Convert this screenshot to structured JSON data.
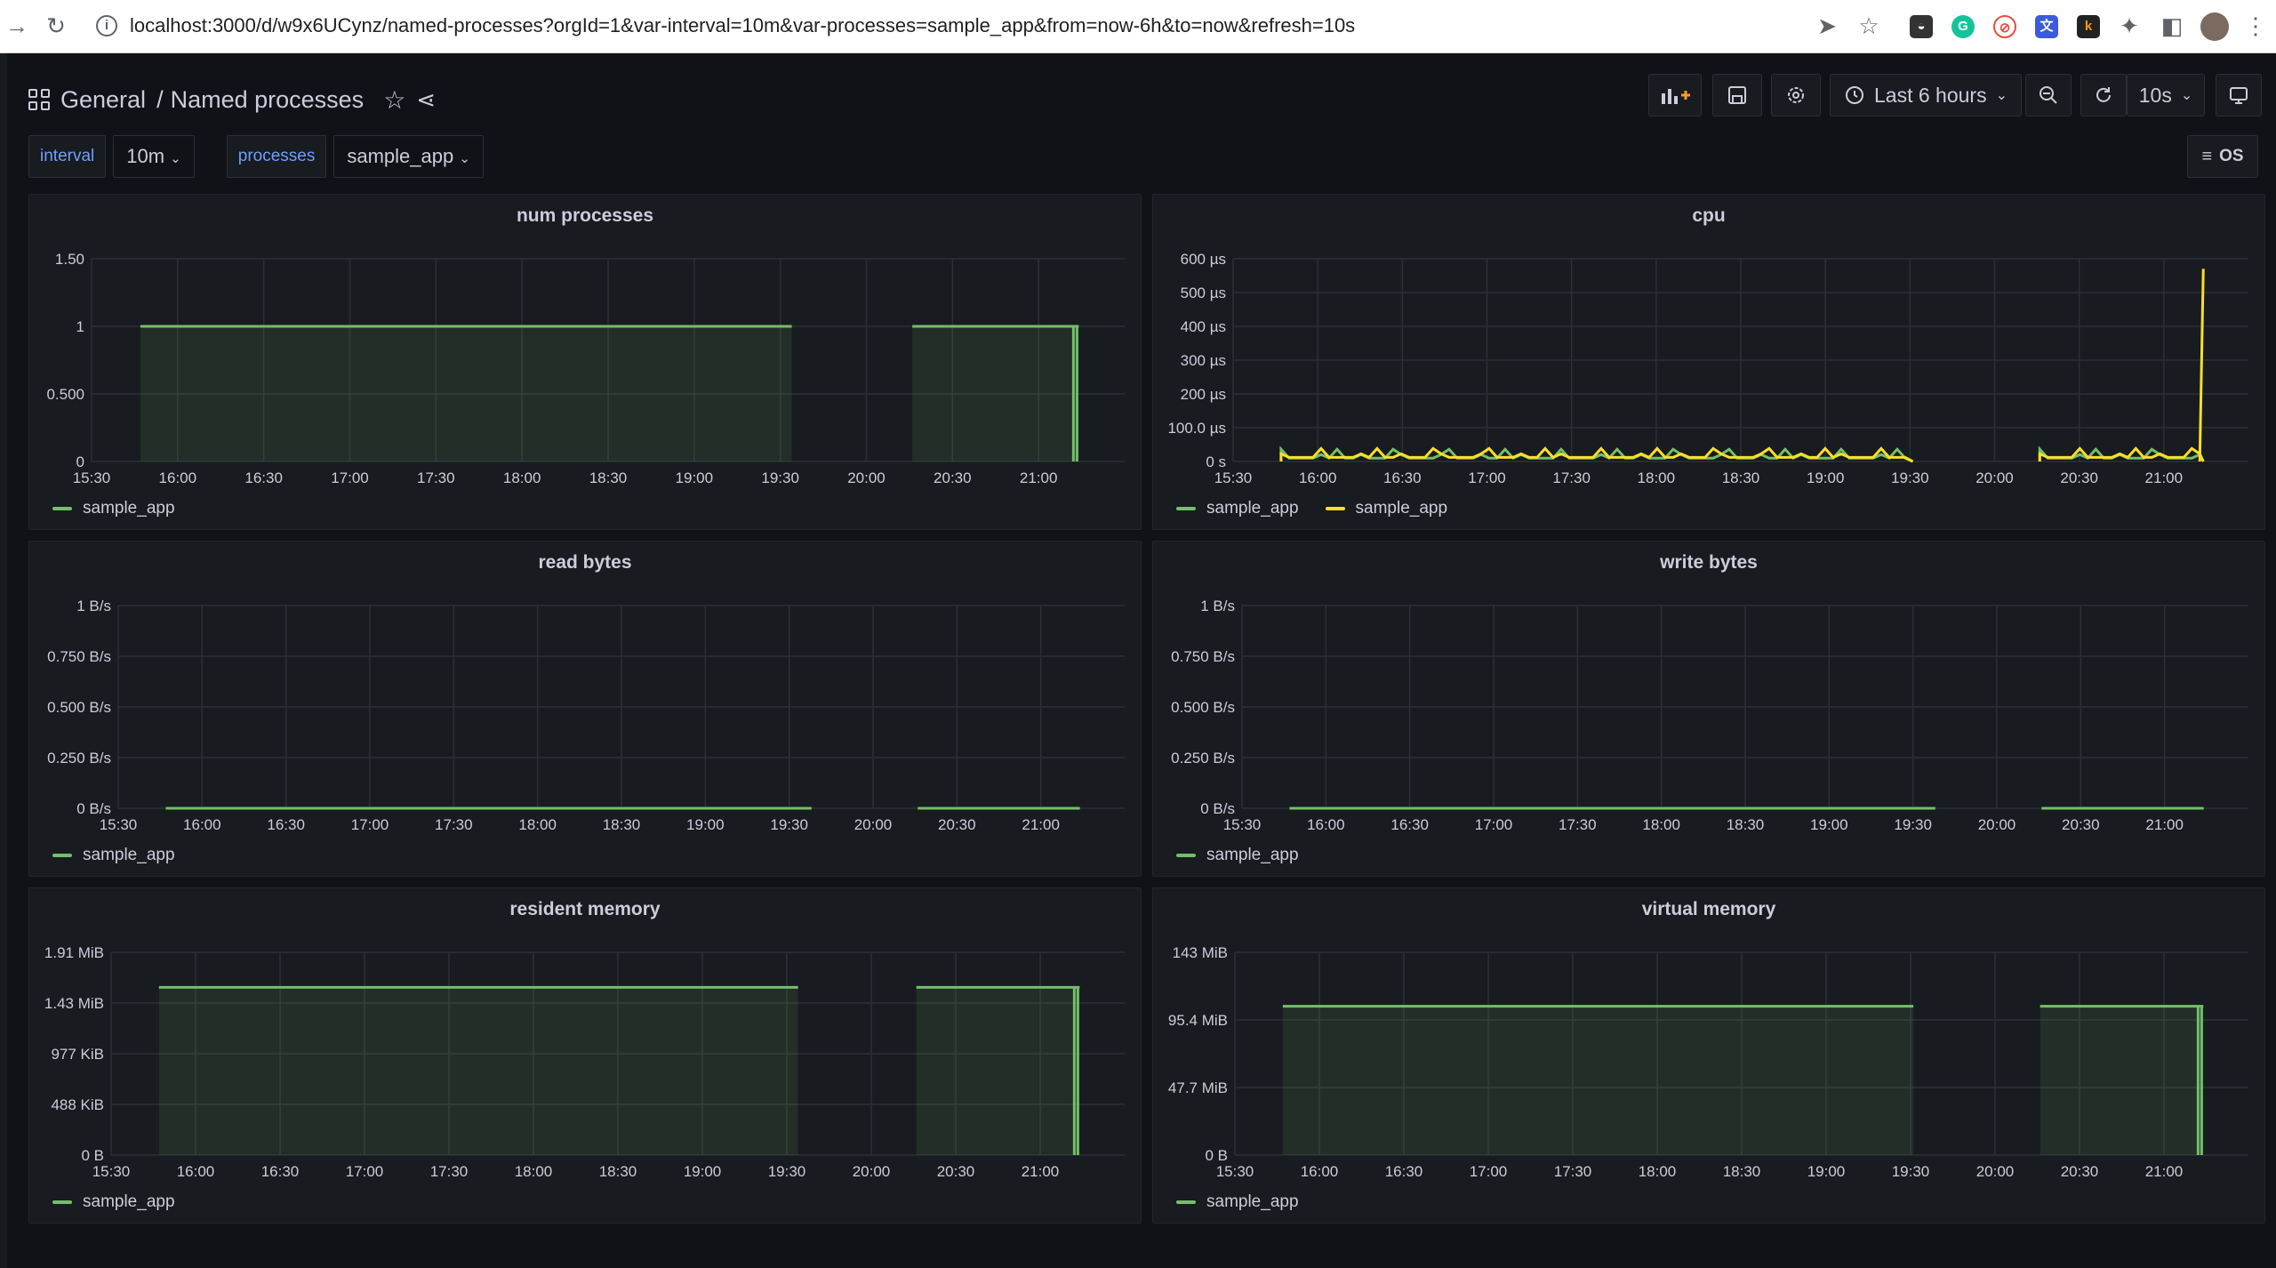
{
  "browser": {
    "url": "localhost:3000/d/w9x6UCynz/named-processes?orgId=1&var-interval=10m&var-processes=sample_app&from=now-6h&to=now&refresh=10s"
  },
  "dashboard": {
    "folder": "General",
    "separator": "/",
    "name": "Named processes"
  },
  "toolbar": {
    "time_range": "Last 6 hours",
    "refresh": "10s"
  },
  "variables": [
    {
      "label": "interval",
      "value": "10m"
    },
    {
      "label": "processes",
      "value": "sample_app"
    }
  ],
  "os_button": "OS",
  "colors": {
    "green": "#73bf69",
    "yellow": "#fade2a",
    "background": "#111217",
    "panel": "#181b1f"
  },
  "x_ticks": [
    "15:30",
    "16:00",
    "16:30",
    "17:00",
    "17:30",
    "18:00",
    "18:30",
    "19:00",
    "19:30",
    "20:00",
    "20:30",
    "21:00"
  ],
  "panels": [
    {
      "title": "num processes",
      "legend": [
        "sample_app"
      ]
    },
    {
      "title": "cpu",
      "legend": [
        "sample_app",
        "sample_app"
      ]
    },
    {
      "title": "read bytes",
      "legend": [
        "sample_app"
      ]
    },
    {
      "title": "write bytes",
      "legend": [
        "sample_app"
      ]
    },
    {
      "title": "resident memory",
      "legend": [
        "sample_app"
      ]
    },
    {
      "title": "virtual memory",
      "legend": [
        "sample_app"
      ]
    }
  ],
  "chart_data": [
    {
      "type": "area",
      "title": "num processes",
      "y_ticks": [
        "0",
        "0.500",
        "1",
        "1.50"
      ],
      "ylim": [
        0,
        1.5
      ],
      "x_range": [
        "15:30",
        "21:30"
      ],
      "series": [
        {
          "name": "sample_app",
          "color": "#73bf69",
          "segments": [
            {
              "x_start": "15:47",
              "x_end": "19:34",
              "value": 1
            },
            {
              "x_start": "20:16",
              "x_end": "21:14",
              "value": 1
            }
          ]
        }
      ]
    },
    {
      "type": "line",
      "title": "cpu",
      "y_ticks": [
        "0 s",
        "100.0 µs",
        "200 µs",
        "300 µs",
        "400 µs",
        "500 µs",
        "600 µs"
      ],
      "ylim": [
        0,
        600
      ],
      "unit": "µs",
      "x_range": [
        "15:30",
        "21:30"
      ],
      "series": [
        {
          "name": "sample_app",
          "color": "#73bf69",
          "segments": [
            {
              "x_start": "15:47",
              "x_end": "19:31",
              "value": 10
            },
            {
              "x_start": "20:16",
              "x_end": "21:14",
              "value": 10
            }
          ]
        },
        {
          "name": "sample_app",
          "color": "#fade2a",
          "segments": [
            {
              "x_start": "15:47",
              "x_end": "19:31",
              "value": 12
            },
            {
              "x_start": "20:16",
              "x_end": "21:14",
              "value": 12
            }
          ],
          "spike": {
            "x": "21:14",
            "value": 570
          }
        }
      ]
    },
    {
      "type": "line",
      "title": "read bytes",
      "y_ticks": [
        "0 B/s",
        "0.250 B/s",
        "0.500 B/s",
        "0.750 B/s",
        "1 B/s"
      ],
      "ylim": [
        0,
        1
      ],
      "x_range": [
        "15:30",
        "21:30"
      ],
      "series": [
        {
          "name": "sample_app",
          "color": "#73bf69",
          "segments": [
            {
              "x_start": "15:47",
              "x_end": "19:38",
              "value": 0
            },
            {
              "x_start": "20:16",
              "x_end": "21:14",
              "value": 0
            }
          ]
        }
      ]
    },
    {
      "type": "line",
      "title": "write bytes",
      "y_ticks": [
        "0 B/s",
        "0.250 B/s",
        "0.500 B/s",
        "0.750 B/s",
        "1 B/s"
      ],
      "ylim": [
        0,
        1
      ],
      "x_range": [
        "15:30",
        "21:30"
      ],
      "series": [
        {
          "name": "sample_app",
          "color": "#73bf69",
          "segments": [
            {
              "x_start": "15:47",
              "x_end": "19:38",
              "value": 0
            },
            {
              "x_start": "20:16",
              "x_end": "21:14",
              "value": 0
            }
          ]
        }
      ]
    },
    {
      "type": "area",
      "title": "resident memory",
      "y_ticks": [
        "0 B",
        "488 KiB",
        "977 KiB",
        "1.43 MiB",
        "1.91 MiB"
      ],
      "ylim": [
        0,
        1.91
      ],
      "unit": "MiB",
      "x_range": [
        "15:30",
        "21:30"
      ],
      "series": [
        {
          "name": "sample_app",
          "color": "#73bf69",
          "segments": [
            {
              "x_start": "15:47",
              "x_end": "19:34",
              "value": 1.58
            },
            {
              "x_start": "20:16",
              "x_end": "21:14",
              "value": 1.58
            }
          ]
        }
      ]
    },
    {
      "type": "area",
      "title": "virtual memory",
      "y_ticks": [
        "0 B",
        "47.7 MiB",
        "95.4 MiB",
        "143 MiB"
      ],
      "ylim": [
        0,
        143
      ],
      "unit": "MiB",
      "x_range": [
        "15:30",
        "21:30"
      ],
      "series": [
        {
          "name": "sample_app",
          "color": "#73bf69",
          "segments": [
            {
              "x_start": "15:47",
              "x_end": "19:31",
              "value": 105
            },
            {
              "x_start": "20:16",
              "x_end": "21:14",
              "value": 105
            }
          ]
        }
      ]
    }
  ]
}
